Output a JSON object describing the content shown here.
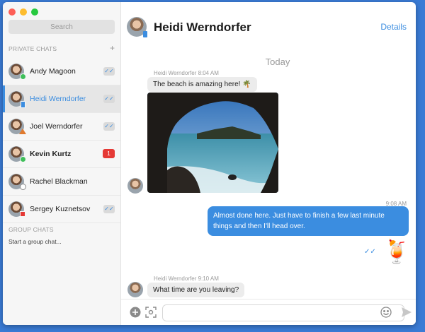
{
  "colors": {
    "accent": "#3b8de0",
    "unread": "#e53935",
    "close": "#fd5f57",
    "minimize": "#fdbc2e",
    "zoom": "#27c93f"
  },
  "search": {
    "placeholder": "Search"
  },
  "sidebar": {
    "private_header": "PRIVATE CHATS",
    "add_icon": "plus-icon",
    "chats": [
      {
        "name": "Andy Magoon",
        "status": "green-circle",
        "badge": "read"
      },
      {
        "name": "Heidi Wernd​orfer",
        "status": "blue-rect",
        "badge": "read",
        "active": true
      },
      {
        "name": "Joel Werndorfer",
        "status": "orange-triangle",
        "badge": "read"
      },
      {
        "name": "Kevin Kurtz",
        "status": "green-circle",
        "badge": "1"
      },
      {
        "name": "Rachel Blackman",
        "status": "gray-circle",
        "badge": ""
      },
      {
        "name": "Sergey Kuznetsov",
        "status": "red-square",
        "badge": "read"
      }
    ],
    "group_header": "GROUP CHATS",
    "start_group": "Start a group chat..."
  },
  "header": {
    "name": "Heidi Werndorfer",
    "details": "Details"
  },
  "conversation": {
    "day": "Today",
    "msg1": {
      "sender": "Heidi Werndorfer",
      "time": "8:04 AM",
      "text": "The beach is amazing here!",
      "emoji": "🌴"
    },
    "photo": {
      "icon": "beach-photo"
    },
    "msg2": {
      "time": "9:08 AM",
      "text": "Almost done here. Just have to finish a few last minute things and then I'll head over."
    },
    "msg2_sticker": "🍹",
    "msg3": {
      "sender": "Heidi Werndorfer",
      "time": "9:10 AM",
      "text": "What time are you leaving?"
    }
  },
  "composer": {
    "value": "",
    "placeholder": ""
  }
}
